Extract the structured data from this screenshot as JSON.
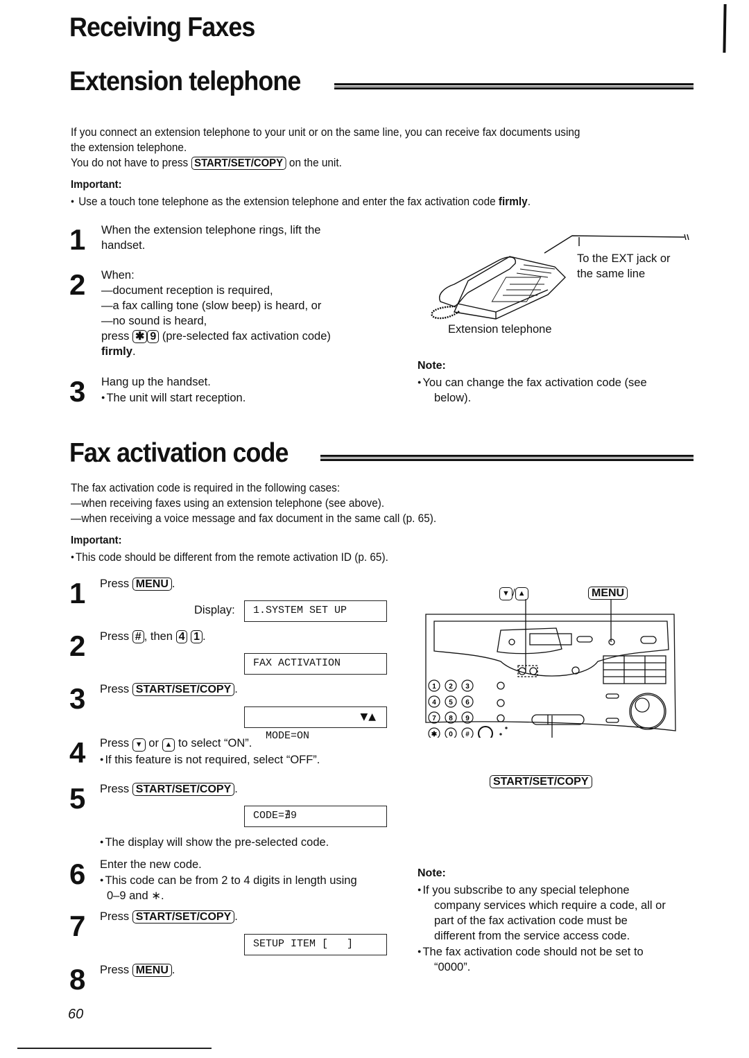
{
  "header": {
    "chapter_title": "Receiving Faxes"
  },
  "extension_section": {
    "title": "Extension telephone",
    "intro_lines": [
      "If you connect an extension telephone to your unit or on the same line, you can receive fax documents using",
      "the extension telephone."
    ],
    "press_prefix": "You do not have to press",
    "press_key": "START/SET/COPY",
    "press_suffix": "on the unit.",
    "important_label": "Important:",
    "important_text_prefix": "Use a touch tone telephone as the extension telephone and enter the fax activation code",
    "important_text_bold": "firmly",
    "important_text_suffix": ".",
    "steps": [
      {
        "number": "1",
        "lines": [
          "When the extension telephone rings, lift the",
          "handset."
        ]
      },
      {
        "number": "2",
        "lines": [
          "When:",
          "—document reception is required,",
          "—a fax calling tone (slow beep) is heard, or",
          "—no sound is heard,"
        ],
        "press_prefix": "press",
        "keys": [
          "✱",
          "9"
        ],
        "press_suffix": "(pre-selected fax activation code)",
        "bold_end": "firmly",
        "bold_end_suffix": "."
      },
      {
        "number": "3",
        "lines": [
          "Hang up the handset."
        ],
        "bullet": "The unit will start reception."
      }
    ],
    "illustration": {
      "callout_lines": [
        "To the EXT jack or",
        "the same line"
      ],
      "caption": "Extension telephone"
    },
    "note_label": "Note:",
    "note_lines": [
      "You can change the fax activation code (see",
      "below)."
    ]
  },
  "fax_code_section": {
    "title": "Fax activation code",
    "intro_lines": [
      "The fax activation code is required in the following cases:",
      "—when receiving faxes using an extension telephone (see above).",
      "—when receiving a voice message and fax document in the same call (p. 65)."
    ],
    "important_label": "Important:",
    "important_text": "This code should be different from the remote activation ID (p. 65).",
    "steps": [
      {
        "number": "1",
        "press": "Press",
        "key": "MENU",
        "suffix": ".",
        "display_label": "Display:",
        "display": "1.SYSTEM SET UP"
      },
      {
        "number": "2",
        "press": "Press",
        "key": "#",
        "middle": ", then",
        "keys2": [
          "4",
          "1"
        ],
        "suffix": ".",
        "display": "FAX ACTIVATION"
      },
      {
        "number": "3",
        "press": "Press",
        "key": "START/SET/COPY",
        "suffix": ".",
        "display": "MODE=ON",
        "display_arrows": "▼▲"
      },
      {
        "number": "4",
        "press": "Press",
        "key": "▼",
        "middle": "or",
        "key_b": "▲",
        "suffix": "to select “ON”.",
        "bullet": "If this feature is not required, select “OFF”."
      },
      {
        "number": "5",
        "press": "Press",
        "key": "START/SET/COPY",
        "suffix": ".",
        "display": "CODE=∄9",
        "bullet": "The display will show the pre-selected code."
      },
      {
        "number": "6",
        "text": "Enter the new code.",
        "bullet_lines": [
          "This code can be from 2 to 4 digits in length using",
          "0–9 and ∗."
        ]
      },
      {
        "number": "7",
        "press": "Press",
        "key": "START/SET/COPY",
        "suffix": ".",
        "display": "SETUP ITEM [   ]"
      },
      {
        "number": "8",
        "press": "Press",
        "key": "MENU",
        "suffix": "."
      }
    ],
    "panel": {
      "label_arrows_down": "▼",
      "label_arrows_sep": "/",
      "label_arrows_up": "▲",
      "label_menu": "MENU",
      "label_start": "START/SET/COPY",
      "keypad": [
        "1",
        "2",
        "3",
        "4",
        "5",
        "6",
        "7",
        "8",
        "9",
        "✱",
        "0",
        "#"
      ]
    },
    "note_label": "Note:",
    "notes": [
      [
        "If you subscribe to any special telephone",
        "company services which require a code, all or",
        "part of the fax activation code must be",
        "different from the service access code."
      ],
      [
        "The fax activation code should not be set to",
        "“0000”."
      ]
    ]
  },
  "footer": {
    "page_number": "60"
  }
}
